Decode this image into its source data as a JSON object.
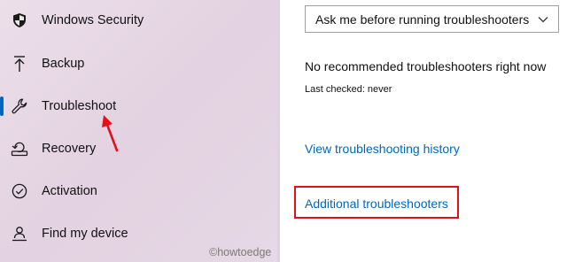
{
  "sidebar": {
    "items": [
      {
        "label": "Windows Security",
        "icon": "shield-icon"
      },
      {
        "label": "Backup",
        "icon": "upload-arrow-icon"
      },
      {
        "label": "Troubleshoot",
        "icon": "wrench-icon",
        "selected": true
      },
      {
        "label": "Recovery",
        "icon": "recovery-drive-icon"
      },
      {
        "label": "Activation",
        "icon": "check-circle-icon"
      },
      {
        "label": "Find my device",
        "icon": "person-pin-icon"
      }
    ]
  },
  "main": {
    "dropdown": {
      "value": "Ask me before running troubleshooters",
      "icon": "chevron-down-icon"
    },
    "status": "No recommended troubleshooters right now",
    "last_checked": "Last checked: never",
    "history_link": "View troubleshooting history",
    "additional_link": "Additional troubleshooters"
  },
  "watermark": "©howtoedge",
  "colors": {
    "accent": "#0067c0",
    "highlight": "#e3101a"
  }
}
